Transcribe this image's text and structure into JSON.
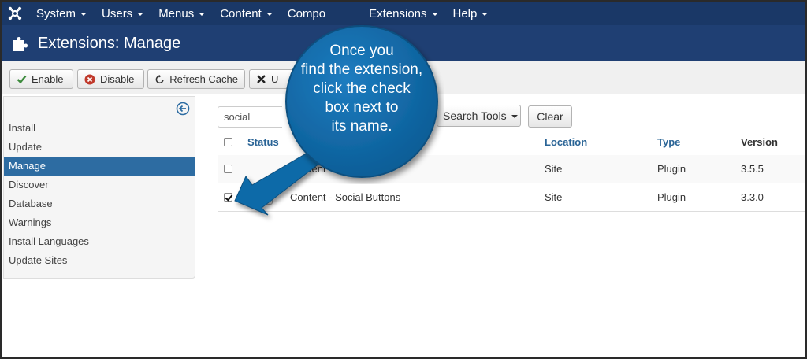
{
  "navbar": {
    "logo_icon": "joomla-logo-icon",
    "items": [
      {
        "label": "System"
      },
      {
        "label": "Users"
      },
      {
        "label": "Menus"
      },
      {
        "label": "Content"
      },
      {
        "label": "Compo"
      },
      {
        "label": "Extensions"
      },
      {
        "label": "Help"
      }
    ]
  },
  "header": {
    "icon": "puzzle-piece-icon",
    "title": "Extensions: Manage"
  },
  "toolbar": {
    "enable_label": "Enable",
    "disable_label": "Disable",
    "refresh_label": "Refresh Cache",
    "uninstall_label": "U"
  },
  "sidebar": {
    "items": [
      {
        "label": "Install",
        "active": false
      },
      {
        "label": "Update",
        "active": false
      },
      {
        "label": "Manage",
        "active": true
      },
      {
        "label": "Discover",
        "active": false
      },
      {
        "label": "Database",
        "active": false
      },
      {
        "label": "Warnings",
        "active": false
      },
      {
        "label": "Install Languages",
        "active": false
      },
      {
        "label": "Update Sites",
        "active": false
      }
    ]
  },
  "filters": {
    "search_value": "social",
    "search_tools_label": "Search Tools",
    "clear_label": "Clear"
  },
  "table": {
    "columns": {
      "status": "Status",
      "location": "Location",
      "type": "Type",
      "version": "Version"
    },
    "rows": [
      {
        "name": "Content - Soci",
        "location": "Site",
        "type": "Plugin",
        "version": "3.5.5",
        "checked": false
      },
      {
        "name": "Content - Social Buttons",
        "location": "Site",
        "type": "Plugin",
        "version": "3.3.0",
        "checked": true
      }
    ]
  },
  "callout": {
    "lines": [
      "Once you",
      "find the extension,",
      "click the check",
      "box next to",
      "its name."
    ]
  },
  "colors": {
    "navbar": "#1a3867",
    "header": "#1f3f73",
    "active_item": "#2d6ca2",
    "callout_fill": "#0f6aa8",
    "arrow_fill": "#0f6aa8"
  }
}
